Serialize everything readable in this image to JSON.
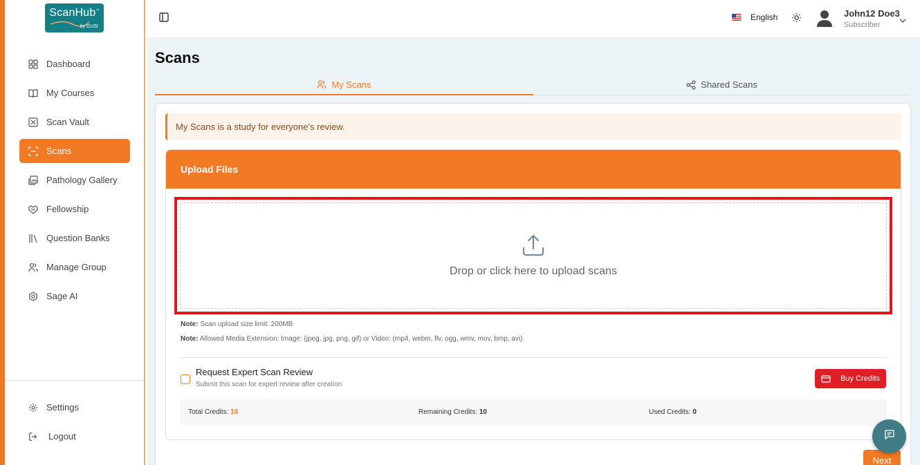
{
  "brand": {
    "name": "ScanHub",
    "tm": "™",
    "sub": "by GUSI",
    "color": "#137f86"
  },
  "accent": "#f27a24",
  "sidebar": {
    "items": [
      {
        "label": "Dashboard",
        "icon": "grid-icon"
      },
      {
        "label": "My Courses",
        "icon": "book-open-icon"
      },
      {
        "label": "Scan Vault",
        "icon": "vault-icon"
      },
      {
        "label": "Scans",
        "icon": "scan-icon",
        "active": true
      },
      {
        "label": "Pathology Gallery",
        "icon": "gallery-icon"
      },
      {
        "label": "Fellowship",
        "icon": "handshake-icon"
      },
      {
        "label": "Question Banks",
        "icon": "library-icon"
      },
      {
        "label": "Manage Group",
        "icon": "users-icon"
      },
      {
        "label": "Sage AI",
        "icon": "sage-ai-icon"
      }
    ],
    "footer": [
      {
        "label": "Settings",
        "icon": "gear-icon"
      },
      {
        "label": "Logout",
        "icon": "logout-icon"
      }
    ]
  },
  "topbar": {
    "language": "English",
    "user": {
      "name": "John12 Doe3",
      "role": "Subscriber"
    }
  },
  "page": {
    "title": "Scans",
    "tabs": [
      {
        "label": "My Scans",
        "active": true
      },
      {
        "label": "Shared Scans",
        "active": false
      }
    ],
    "alert": "My Scans is a study for everyone's review.",
    "upload": {
      "header": "Upload Files",
      "dropzone_text": "Drop or click here to upload scans",
      "note_prefix": "Note:",
      "note1": "Scan upload size limit: 200MB",
      "note2": "Allowed Media Extension: Image: (jpeg, jpg, png, gif) or Video: (mp4, webm, flv, ogg, wmv, mov, bmp, avi)"
    },
    "expert_review": {
      "title": "Request Expert Scan Review",
      "subtitle": "Submit this scan for expert review after creation",
      "checked": false,
      "buy_label": "Buy Credits",
      "buy_color": "#df1f25"
    },
    "credits": {
      "total_label": "Total Credits:",
      "total_value": "10",
      "remaining_label": "Remaining Credits:",
      "remaining_value": "10",
      "used_label": "Used Credits:",
      "used_value": "0"
    },
    "next_label": "Next"
  }
}
